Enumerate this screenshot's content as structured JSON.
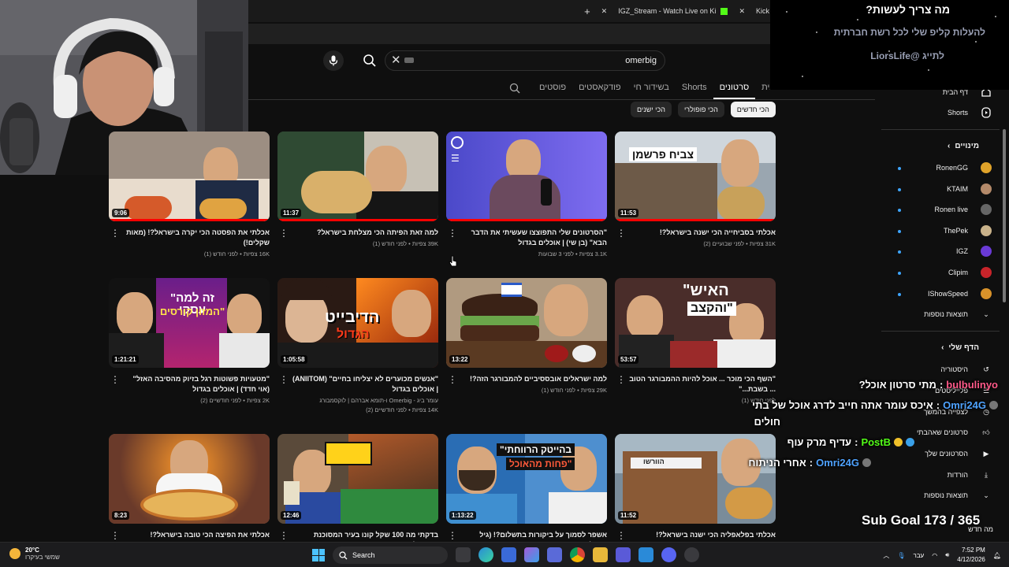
{
  "browser": {
    "tabs": [
      {
        "label": "IGZ_Stream - Watch Live on Ki"
      },
      {
        "label": "Kick"
      }
    ]
  },
  "search": {
    "value": "omerbig"
  },
  "channel_tabs": [
    "דף הבית",
    "סרטונים",
    "Shorts",
    "בשידור חי",
    "פודקאסטים",
    "פוסטים"
  ],
  "chips": [
    "הכי חדשים",
    "הכי פופולרי",
    "הכי ישנים"
  ],
  "videos": [
    {
      "title": "אכלתי בסביחייה הכי ישנה בישראל?!",
      "meta": "31K צפיות • לפני שבועיים (2)",
      "duration": "11:53"
    },
    {
      "title": "\"הסרטונים שלי התפוצצו שעשיתי את הדבר הבא\" (בן שי) | אוכלים בגדול",
      "meta": "3.1K צפיות • לפני 3 שבועות",
      "duration": ""
    },
    {
      "title": "למה זאת הפיתה הכי מצלחת בישראל?",
      "meta": "39K צפיות • לפני חודש (1)",
      "duration": "11:37"
    },
    {
      "title": "אכלתי את הפסטה הכי יקרה בישראל?! (מאות שקלים!)",
      "meta": "16K צפיות • לפני חודש (1)",
      "duration": "9:06"
    },
    {
      "title": "\"השף הכי מוכר ... אוכל להיות ההמבורגר הטוב ... בשבת...\"",
      "meta": "לפני חודש (1)",
      "duration": "53:57"
    },
    {
      "title": "למה ישראלים אובססיביים להמבורגר הזה?!",
      "meta": "29K צפיות • לפני חודש (1)",
      "duration": "13:22"
    },
    {
      "title": "\"אנשים מכוערים לא יצליחו בחיים\" (ANIITOM) | אוכלים בגדול",
      "meta": "עומר ביג - Omerbig ו-תומא אברהם | לוקסמבורג",
      "meta2": "14K צפיות • לפני חודשיים (2)",
      "duration": "1:05:58"
    },
    {
      "title": "\"מטעויות פשוטות רגל בזיוק מהסיבה האזל\" (אוי חדד) | אוכלים בגדול",
      "meta": "2K צפיות • לפני חודשיים (2)",
      "duration": "1:21:21"
    },
    {
      "title": "אכלתי בפלאפליה הכי ישנה בישראל?!",
      "meta": "",
      "duration": "11:52"
    },
    {
      "title": "אשפר לסמוך על ביקורות בתשלום?! (גיל הראל) |",
      "meta": "",
      "duration": "1:13:22"
    },
    {
      "title": "בדקתי מה 100 שקל קונו בעיר המסוכנת בישראל?!",
      "meta": "",
      "duration": "12:46"
    },
    {
      "title": "אכלתי את הפיצה הכי טובה בישראל?!",
      "meta": "",
      "duration": "8:23"
    }
  ],
  "thumb_text": {
    "v1": "צביח פרשמן",
    "v5a": "\"האיש",
    "v5b": "והקצב\"",
    "v7a": "הדיבייט",
    "v7b": "הגדול",
    "v8a": "\"זה למה עסקי",
    "v8b": "המזון קורסים\"",
    "v10a": "\"בהייטק הרווחתי",
    "v10b": "פחות מהאוכל\"",
    "v9": "הוורשו"
  },
  "sidebar": {
    "home": "דף הבית",
    "shorts": "Shorts",
    "subs_header": "מינויים",
    "subs": [
      "RonenGG",
      "KTAIM",
      "Ronen live",
      "ThePek",
      "IGZ",
      "Clipim",
      "IShowSpeed"
    ],
    "more": "תוצאות נוספות",
    "you_header": "הדף שלי",
    "you": [
      "היסטוריה",
      "פלייליסטים",
      "לצפייה בהמשך",
      "סרטונים שאהבתי",
      "הסרטונים שלך",
      "הורדות"
    ],
    "more2": "תוצאות נוספות",
    "new": "מה חדש"
  },
  "overlay": {
    "todo_title": "מה צריך לעשות?",
    "todo_line1": "להעלות קליפ שלי לכל רשת חברתית",
    "todo_line2": "לתייג @LiorsLife",
    "chat": [
      {
        "user": "bulbulinyo",
        "sep": ":",
        "text": "מתי סרטון אוכל?"
      },
      {
        "user": "Omri24G",
        "sep": ":",
        "text": "איכס עומר אתה חייב לדרג אוכל של בתי"
      },
      {
        "user": "",
        "sep": "",
        "text": "חולים"
      },
      {
        "user": "PostB",
        "sep": ":",
        "text": "עדיף מרק עוף"
      },
      {
        "user": "Omri24G",
        "sep": ":",
        "text": "אחרי הניתוח"
      }
    ],
    "sub_goal": "Sub Goal 173 / 365"
  },
  "taskbar": {
    "temp": "20°C",
    "weather": "שמשי בעיקרו",
    "search": "Search",
    "lang": "עבר",
    "time": "7:52 PM",
    "date": "4/12/2026"
  }
}
